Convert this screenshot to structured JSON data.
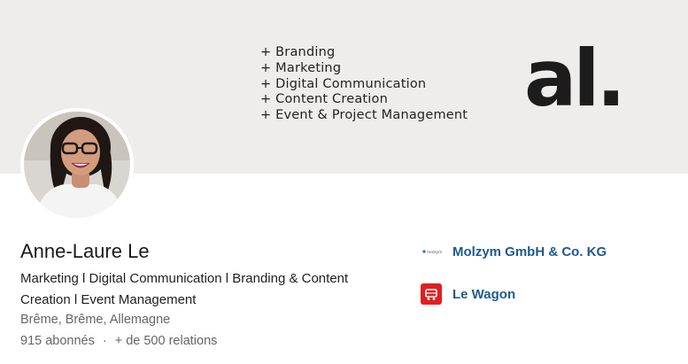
{
  "banner": {
    "lines": [
      "+ Branding",
      "+ Marketing",
      "+ Digital Communication",
      "+ Content Creation",
      "+ Event & Project Management"
    ],
    "logo_text": "al."
  },
  "profile": {
    "name": "Anne-Laure Le",
    "headline": "Marketing l Digital Communication l Branding & Content Creation l Event Management",
    "location": "Brême, Brême, Allemagne",
    "followers": "915 abonnés",
    "separator": "·",
    "connections": "+ de 500 relations"
  },
  "organizations": [
    {
      "name": "Molzym GmbH & Co. KG",
      "logo_text": "molzym",
      "logo_icon": "molzym-logo"
    },
    {
      "name": "Le Wagon",
      "logo_icon": "le-wagon-logo",
      "color": "#e02020"
    }
  ]
}
